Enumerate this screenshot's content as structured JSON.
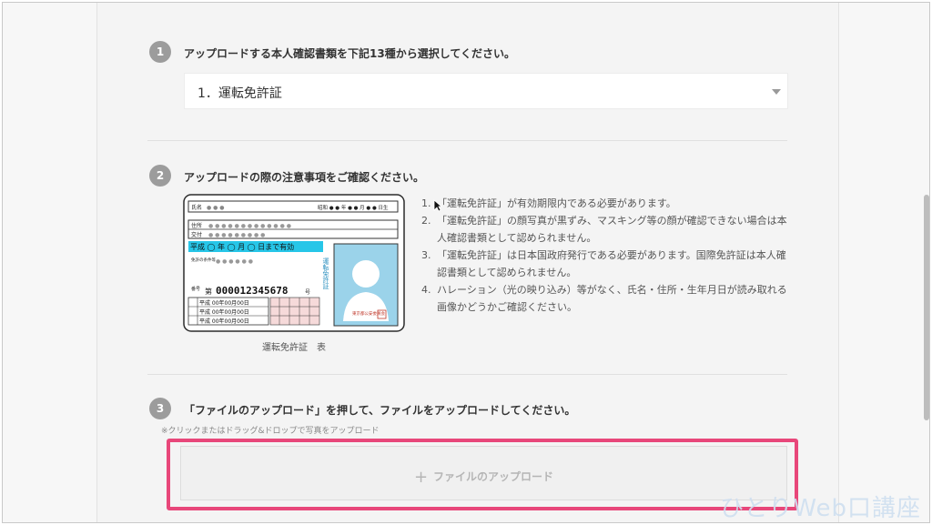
{
  "step1": {
    "number": "1",
    "heading": "アップロードする本人確認書類を下記13種から選択してください。",
    "selected": "1．運転免許証"
  },
  "step2": {
    "number": "2",
    "heading": "アップロードの際の注意事項をご確認ください。",
    "card": {
      "name_label": "氏名",
      "name_dots": "● ● ●",
      "dob_dots": "昭和 ● ● 年 ● ● 月 ● ● 日生",
      "address_label": "住所",
      "issue_label": "交付",
      "valid": "平成 ◯ 年 ◯ 月 ◯ 日まで有効",
      "condition_label": "免許の条件等",
      "title_vertical": "運転免許証",
      "number_prefix": "第",
      "number": "000012345678",
      "number_suffix": "号",
      "dates": [
        "平成 00年00月00日",
        "平成 00年00月00日",
        "平成 00年00月00日"
      ],
      "issuer": "東京都公安委員会"
    },
    "caption": "運転免許証　表",
    "notes": [
      {
        "n": "1.",
        "text": "「運転免許証」が有効期限内である必要があります。"
      },
      {
        "n": "2.",
        "text": "「運転免許証」の顔写真が黒ずみ、マスキング等の顔が確認できない場合は本人確認書類として認められません。"
      },
      {
        "n": "3.",
        "text": "「運転免許証」は日本国政府発行である必要があります。国際免許証は本人確認書類として認められません。"
      },
      {
        "n": "4.",
        "text": "ハレーション（光の映り込み）等がなく、氏名・住所・生年月日が読み取れる画像かどうかご確認ください。"
      }
    ]
  },
  "step3": {
    "number": "3",
    "heading": "「ファイルのアップロード」を押して、ファイルをアップロードしてください。",
    "hint": "※クリックまたはドラッグ&ドロップで写真をアップロード",
    "upload_label": "ファイルのアップロード"
  },
  "watermark": "ひとりWeb口講座",
  "colors": {
    "highlight": "#e8477a",
    "badge": "#9c9c9c",
    "card_valid_bg": "#27c6e8"
  }
}
